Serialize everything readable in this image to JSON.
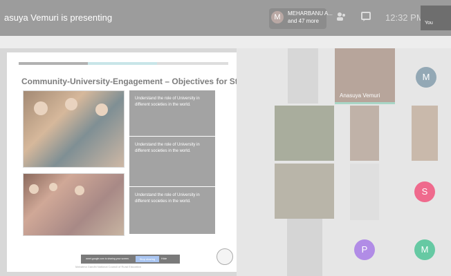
{
  "header": {
    "presenter_text": "asuya Vemuri is presenting",
    "participants_avatar": "M",
    "participants_name": "MEHARBANU A...",
    "participants_more": "and 47 more",
    "time": "12:32 PM",
    "you_label": "You",
    "icons": [
      "people-icon",
      "chat-icon"
    ]
  },
  "slide": {
    "title": "Community-University-Engagement – Objectives for Study",
    "objectives": [
      "Understand the role of University in different societies in the world.",
      "Understand the role of University in different societies in the world.",
      "Understand the role of University in different societies in the world."
    ],
    "share_bar": {
      "message": "meet.google.com is sharing your screen.",
      "stop_label": "Stop sharing",
      "hide_label": "Hide"
    },
    "footer": "Mahatma Gandhi National Council of Rural Education"
  },
  "participants": {
    "tile_name": "Anasuya Vemuri",
    "avatars": [
      {
        "letter": "M",
        "color": "#93a8b5"
      },
      {
        "letter": "S",
        "color": "#ef6a8d"
      },
      {
        "letter": "P",
        "color": "#b18ce6"
      },
      {
        "letter": "M",
        "color": "#66c9a3"
      }
    ]
  }
}
